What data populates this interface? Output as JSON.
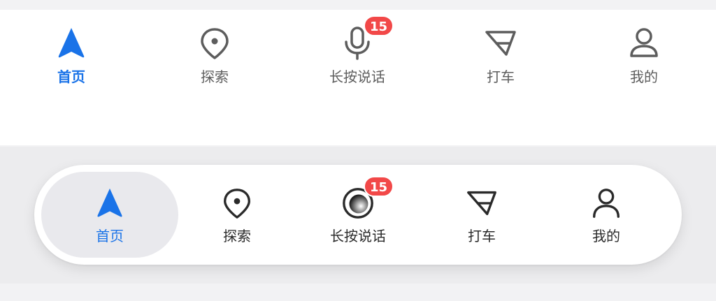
{
  "colors": {
    "accent": "#1a73e8",
    "badge": "#f24848",
    "icon_gray": "#5d5d5d",
    "icon_dark": "#2a2a2a"
  },
  "top_bar": {
    "items": [
      {
        "label": "首页",
        "icon": "navigation-arrow-icon",
        "active": true
      },
      {
        "label": "探索",
        "icon": "location-pin-icon"
      },
      {
        "label": "长按说话",
        "icon": "microphone-icon",
        "badge": "15"
      },
      {
        "label": "打车",
        "icon": "taxi-icon"
      },
      {
        "label": "我的",
        "icon": "user-icon"
      }
    ]
  },
  "floating_bar": {
    "items": [
      {
        "label": "首页",
        "icon": "navigation-arrow-icon",
        "active": true
      },
      {
        "label": "探索",
        "icon": "location-pin-icon"
      },
      {
        "label": "长按说话",
        "icon": "voice-assistant-icon",
        "badge": "15"
      },
      {
        "label": "打车",
        "icon": "taxi-icon"
      },
      {
        "label": "我的",
        "icon": "user-icon"
      }
    ]
  }
}
